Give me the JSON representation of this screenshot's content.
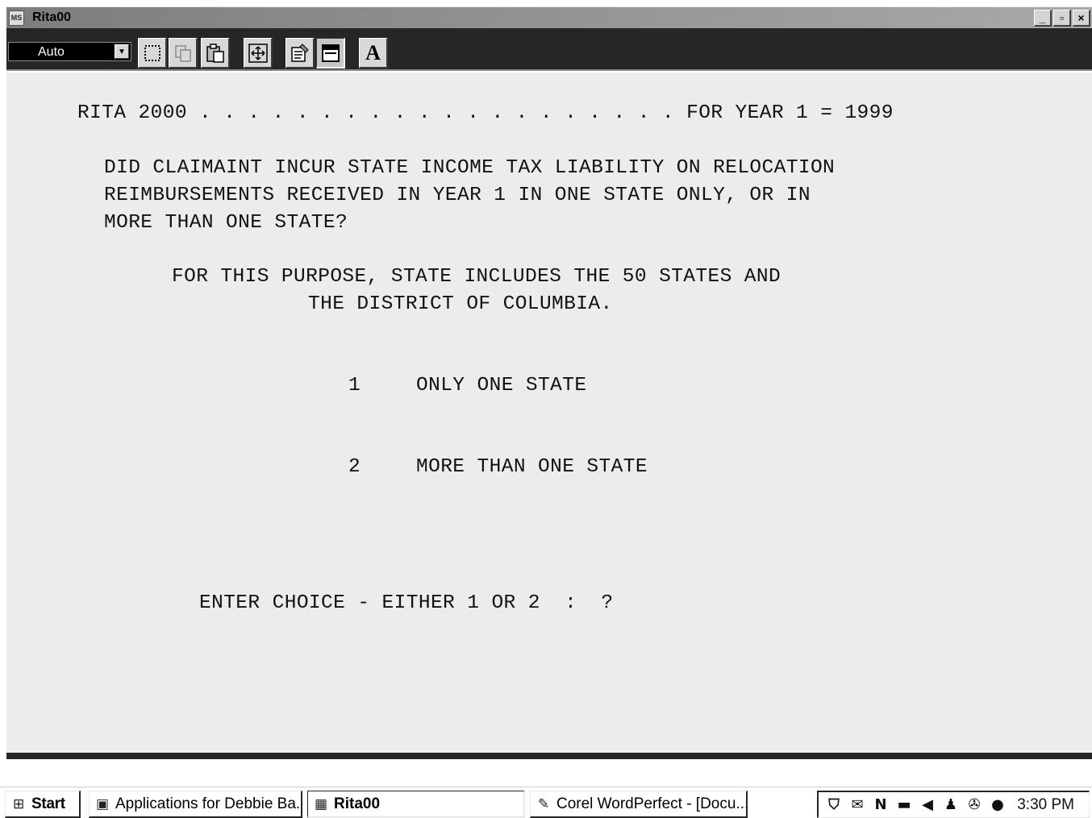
{
  "window": {
    "title": "Rita00",
    "icon_label": "MS",
    "controls": {
      "minimize": "_",
      "restore": "▫",
      "close": "×"
    }
  },
  "toolbar": {
    "font_select_value": "Auto",
    "buttons": [
      "mark-icon",
      "copy-icon",
      "paste-icon",
      "fullscreen-icon",
      "properties-icon",
      "background-icon",
      "font-icon"
    ],
    "font_button_label": "A"
  },
  "terminal": {
    "header_left": "RITA 2000 . . . . . . . . . . . . . . . . . . . . FOR YEAR 1 = 1999",
    "question": [
      "DID CLAIMAINT INCUR STATE INCOME TAX LIABILITY ON RELOCATION",
      "REIMBURSEMENTS RECEIVED IN YEAR 1 IN ONE STATE ONLY, OR IN",
      "MORE THAN ONE STATE?"
    ],
    "note": [
      "FOR THIS PURPOSE, STATE INCLUDES THE 50 STATES AND",
      "THE DISTRICT OF COLUMBIA."
    ],
    "options": [
      {
        "number": "1",
        "label": "ONLY ONE STATE"
      },
      {
        "number": "2",
        "label": "MORE THAN ONE STATE"
      }
    ],
    "prompt": "ENTER CHOICE - EITHER 1 OR 2  :  ?"
  },
  "taskbar": {
    "start_label": "Start",
    "tasks": [
      {
        "label": "Applications for Debbie Ba...",
        "active": false
      },
      {
        "label": "Rita00",
        "active": true
      },
      {
        "label": "Corel WordPerfect - [Docu...",
        "active": false
      }
    ],
    "clock": "3:30 PM"
  }
}
